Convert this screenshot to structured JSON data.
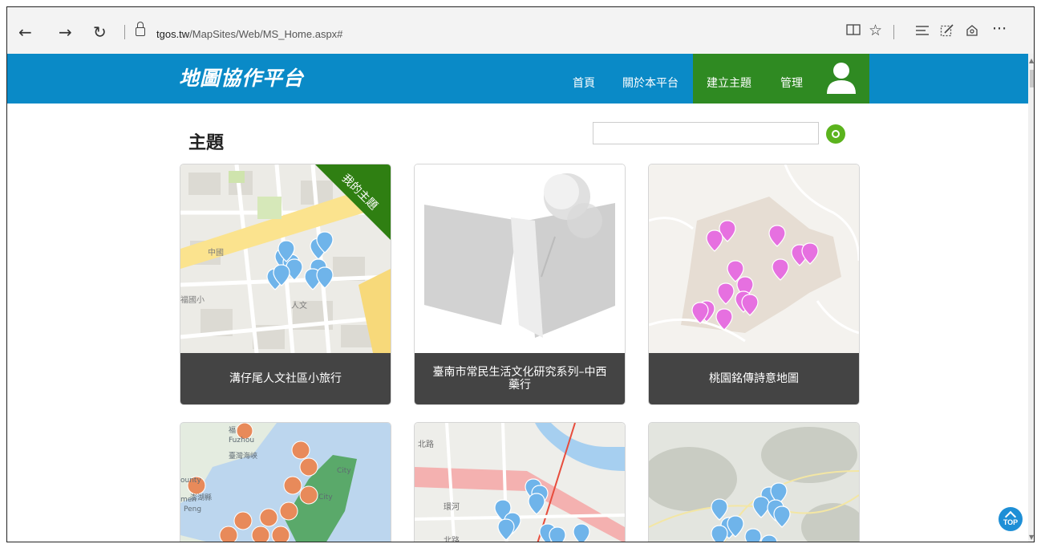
{
  "browser": {
    "url_domain": "tgos.tw",
    "url_path": "/MapSites/Web/MS_Home.aspx#",
    "back_icon": "←",
    "forward_icon": "→",
    "refresh_icon": "↻",
    "lock_icon": "🔒",
    "right_icons": [
      "reading-view-icon",
      "favorite-star-icon",
      "hub-icon",
      "web-note-icon",
      "share-icon",
      "more-icon"
    ]
  },
  "site": {
    "logo": "地圖協作平台",
    "nav": {
      "home": "首頁",
      "about": "關於本平台",
      "create": "建立主題",
      "manage": "管理"
    }
  },
  "main": {
    "title": "主題",
    "search_placeholder": ""
  },
  "cards": [
    {
      "title": "溝仔尾人文社區小旅行",
      "ribbon": "我的主題"
    },
    {
      "title": "臺南市常民生活文化研究系列–中西藥行"
    },
    {
      "title": "桃園銘傳詩意地圖"
    },
    {
      "title": ""
    },
    {
      "title": ""
    },
    {
      "title": ""
    }
  ],
  "map_labels": {
    "card1": [
      "福國小",
      "中國",
      "人文"
    ],
    "card4": [
      "福",
      "Fuzhou",
      "臺灣海峽",
      "City",
      "ounty",
      "澎湖縣",
      "men",
      "Peng",
      "City"
    ],
    "card5": [
      "北路",
      "環河",
      "北路"
    ]
  },
  "top_button": "TOP",
  "colors": {
    "header_blue": "#0a8ac7",
    "active_green": "#2f8a22",
    "ribbon_green": "#2f7f12",
    "caption_gray": "#444444",
    "search_green": "#5bb31d",
    "pin_blue": "#6fb4ea",
    "pin_pink": "#e670e0"
  }
}
